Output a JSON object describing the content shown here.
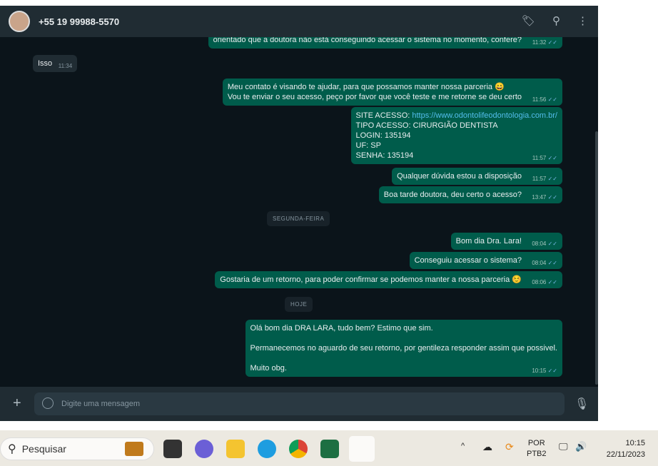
{
  "header": {
    "contact": "+55 19 99988-5570"
  },
  "messages": [
    {
      "dir": "out",
      "text": "orientado que a doutora não está conseguindo acessar o sistema no momento, confere?",
      "time": "11:32"
    },
    {
      "dir": "in",
      "text": "Isso",
      "time": "11:34"
    },
    {
      "dir": "out",
      "lines": [
        "Meu contato é visando te ajudar, para que possamos manter nossa parceria 😄",
        "Vou te enviar o seu acesso, peço por favor que você teste e me retorne se deu certo"
      ],
      "time": "11:56"
    },
    {
      "dir": "out",
      "site_label": "SITE ACESSO:",
      "site_url": "https://www.odontolifeodontologia.com.br/",
      "lines": [
        "TIPO ACESSO: CIRURGIÃO DENTISTA",
        "LOGIN: 135194",
        "UF: SP",
        "SENHA: 135194"
      ],
      "time": "11:57"
    },
    {
      "dir": "out",
      "text": "Qualquer dúvida estou a disposição",
      "time": "11:57"
    },
    {
      "dir": "out",
      "text": "Boa tarde doutora, deu certo o acesso?",
      "time": "13:47"
    },
    {
      "dir": "out",
      "text": "Bom dia Dra. Lara!",
      "time": "08:04"
    },
    {
      "dir": "out",
      "text": "Conseguiu acessar o sistema?",
      "time": "08:04"
    },
    {
      "dir": "out",
      "text": "Gostaria de um retorno, para poder confirmar se podemos manter a nossa parceria ☺️",
      "time": "08:06"
    },
    {
      "dir": "out",
      "lines": [
        "Olá bom dia DRA LARA, tudo bem? Estimo que sim.",
        "Permanecemos no aguardo de seu retorno, por gentileza responder assim que possivel.",
        "Muito obg."
      ],
      "time": "10:15"
    }
  ],
  "days": [
    "SEGUNDA-FEIRA",
    "HOJE"
  ],
  "composer": {
    "placeholder": "Digite uma mensagem"
  },
  "taskbar": {
    "search": "Pesquisar",
    "lang1": "POR",
    "lang2": "PTB2",
    "time": "10:15",
    "date": "22/11/2023"
  }
}
